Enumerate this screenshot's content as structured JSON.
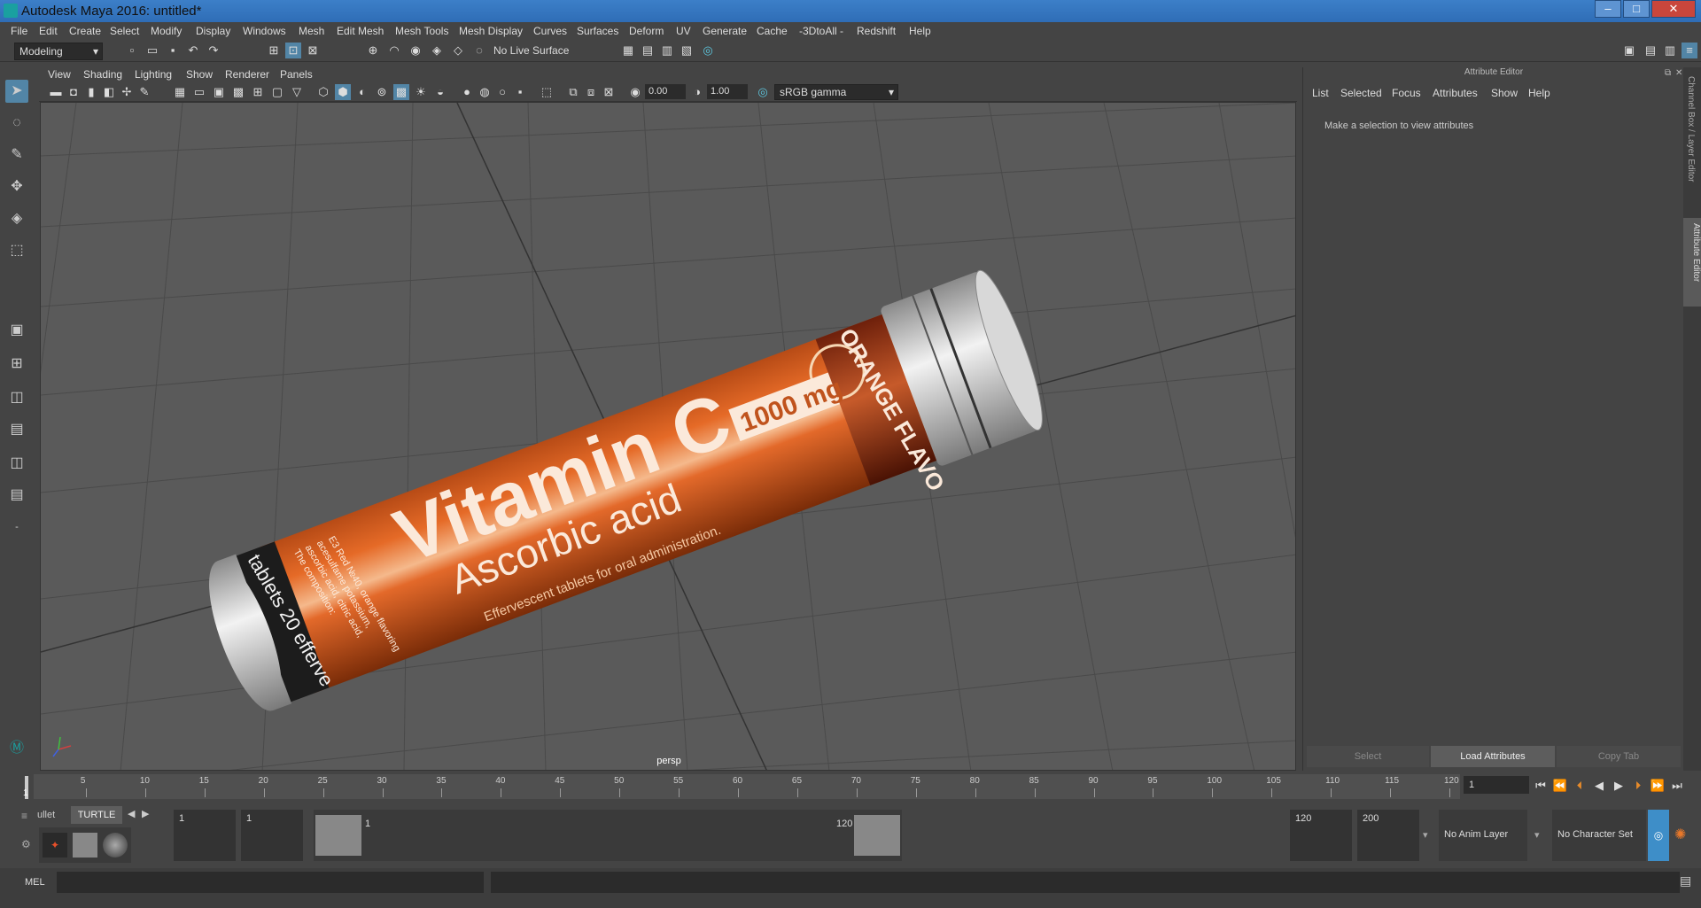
{
  "window": {
    "title": "Autodesk Maya 2016: untitled*",
    "controls": [
      "–",
      "□",
      "✕"
    ]
  },
  "menubar": [
    "File",
    "Edit",
    "Create",
    "Select",
    "Modify",
    "Display",
    "Windows",
    "Mesh",
    "Edit Mesh",
    "Mesh Tools",
    "Mesh Display",
    "Curves",
    "Surfaces",
    "Deform",
    "UV",
    "Generate",
    "Cache",
    "-3DtoAll -",
    "Redshift",
    "Help"
  ],
  "shelf": {
    "mode": "Modeling",
    "live_surface": "No Live Surface"
  },
  "viewport": {
    "menus": [
      "View",
      "Shading",
      "Lighting",
      "Show",
      "Renderer",
      "Panels"
    ],
    "exposure": "0.00",
    "gamma": "1.00",
    "color_space": "sRGB gamma",
    "camera_label": "persp"
  },
  "product": {
    "brand_line1": "Vitamin C",
    "dose": "1000 mg",
    "sub": "Ascorbic acid",
    "flavor": "ORANGE FLAVO",
    "tablets": "tablets 20 efferve",
    "tagline": "Effervescent tablets for oral administration.",
    "composition_lines": [
      "The composition:",
      "ascorbic acid, citric acid,",
      "acesulfame potassium,",
      "E3 Red №40, orange flavoring"
    ]
  },
  "attribute_editor": {
    "title": "Attribute Editor",
    "menus": [
      "List",
      "Selected",
      "Focus",
      "Attributes",
      "Show",
      "Help"
    ],
    "message": "Make a selection to view attributes",
    "buttons": {
      "select": "Select",
      "load": "Load Attributes",
      "copy": "Copy Tab"
    }
  },
  "side_tabs": [
    "Channel Box / Layer Editor",
    "Attribute Editor"
  ],
  "timeline": {
    "ticks": [
      5,
      10,
      15,
      20,
      25,
      30,
      35,
      40,
      45,
      50,
      55,
      60,
      65,
      70,
      75,
      80,
      85,
      90,
      95,
      100,
      105,
      110,
      115,
      120
    ],
    "current_frame_marker": "1",
    "current_frame": "1"
  },
  "range": {
    "shelf_tabs": [
      "ullet",
      "TURTLE"
    ],
    "start": "1",
    "playback_start": "1",
    "slider_start": "1",
    "slider_end": "120",
    "playback_end": "120",
    "end": "200",
    "anim_layer": "No Anim Layer",
    "char_set": "No Character Set"
  },
  "cmd": {
    "label": "MEL"
  }
}
